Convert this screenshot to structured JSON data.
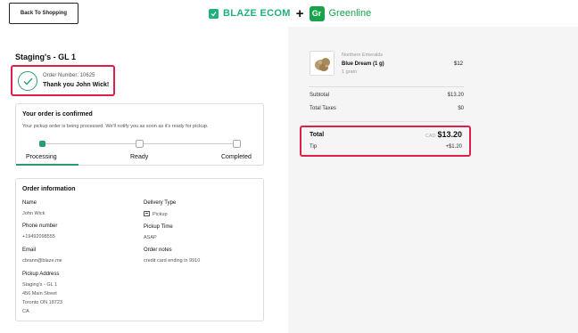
{
  "header": {
    "back_label": "Back To Shopping",
    "brand_blaze": "BLAZE ECOM",
    "brand_plus": "+",
    "brand_gr_icon": "Gr",
    "brand_greenline": "Greenline"
  },
  "order": {
    "store_title": "Staging's - GL 1",
    "order_number": "Order Number: 10625",
    "thank_you": "Thank you John Wick!"
  },
  "confirmation": {
    "title": "Your order is confirmed",
    "description": "Your pickup order is being processed. We'll notify you as soon as it's ready for pickup.",
    "steps": [
      "Processing",
      "Ready",
      "Completed"
    ],
    "current_step": 0
  },
  "order_info": {
    "title": "Order information",
    "name_label": "Name",
    "name_value": "John Wick",
    "phone_label": "Phone number",
    "phone_value": "+19492098555",
    "email_label": "Email",
    "email_value": "cbrann@blaze.me",
    "address_label": "Pickup Address",
    "address_lines": [
      "Staging's - GL 1",
      "456 Main Street",
      "Toronto ON 18723",
      "CA"
    ],
    "delivery_label": "Delivery Type",
    "delivery_value": "Pickup",
    "pickup_time_label": "Pickup Time",
    "pickup_time_value": "ASAP",
    "notes_label": "Order notes",
    "notes_value": "credit card ending in 9910"
  },
  "cart": {
    "item": {
      "brand": "Northern Emeralds",
      "name": "Blue Dream (1 g)",
      "size": "1 gram",
      "price": "$12"
    },
    "subtotal_label": "Subtotal",
    "subtotal_value": "$13.20",
    "taxes_label": "Total Taxes",
    "taxes_value": "$0",
    "total_label": "Total",
    "total_currency": "CAD",
    "total_value": "$13.20",
    "tip_label": "Tip",
    "tip_value": "+$1.20"
  },
  "colors": {
    "accent_green": "#2a9d6c",
    "highlight_red": "#e11d48",
    "panel_gray": "#f5f5f5"
  }
}
